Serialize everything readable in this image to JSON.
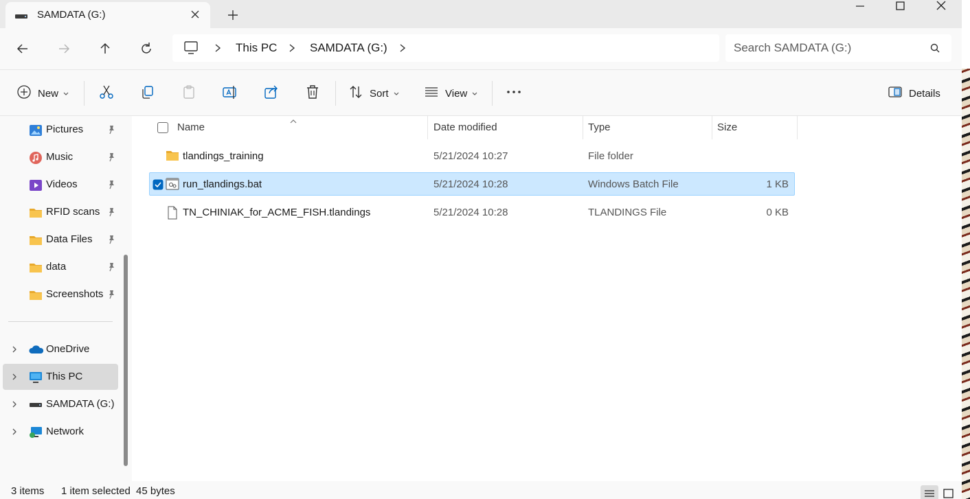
{
  "window": {
    "tab_title": "SAMDATA (G:)"
  },
  "address": {
    "crumbs": [
      "This PC",
      "SAMDATA (G:)"
    ]
  },
  "search": {
    "placeholder": "Search SAMDATA (G:)"
  },
  "toolbar": {
    "new_label": "New",
    "sort_label": "Sort",
    "view_label": "View",
    "details_label": "Details"
  },
  "sidebar": {
    "quick_access": [
      {
        "label": "Pictures",
        "icon": "pictures-icon"
      },
      {
        "label": "Music",
        "icon": "music-icon"
      },
      {
        "label": "Videos",
        "icon": "videos-icon"
      },
      {
        "label": "RFID scans",
        "icon": "folder-icon"
      },
      {
        "label": "Data Files",
        "icon": "folder-icon"
      },
      {
        "label": "data",
        "icon": "folder-icon"
      },
      {
        "label": "Screenshots",
        "icon": "folder-icon"
      }
    ],
    "locations": [
      {
        "label": "OneDrive",
        "icon": "onedrive-icon"
      },
      {
        "label": "This PC",
        "icon": "this-pc-icon",
        "selected": true
      },
      {
        "label": "SAMDATA (G:)",
        "icon": "drive-icon"
      },
      {
        "label": "Network",
        "icon": "network-icon"
      }
    ]
  },
  "table": {
    "columns": [
      "Name",
      "Date modified",
      "Type",
      "Size"
    ],
    "rows": [
      {
        "name": "tlandings_training",
        "date": "5/21/2024 10:27",
        "type": "File folder",
        "size": "",
        "icon": "folder-icon",
        "selected": false
      },
      {
        "name": "run_tlandings.bat",
        "date": "5/21/2024 10:28",
        "type": "Windows Batch File",
        "size": "1 KB",
        "icon": "batch-file-icon",
        "selected": true
      },
      {
        "name": "TN_CHINIAK_for_ACME_FISH.tlandings",
        "date": "5/21/2024 10:28",
        "type": "TLANDINGS File",
        "size": "0 KB",
        "icon": "file-icon",
        "selected": false
      }
    ]
  },
  "status": {
    "item_count": "3 items",
    "selection": "1 item selected",
    "bytes": "45 bytes"
  },
  "colors": {
    "accent": "#0067c0",
    "selection_bg": "#cce8ff",
    "selection_border": "#99d1ff",
    "folder": "#f8c44e"
  }
}
